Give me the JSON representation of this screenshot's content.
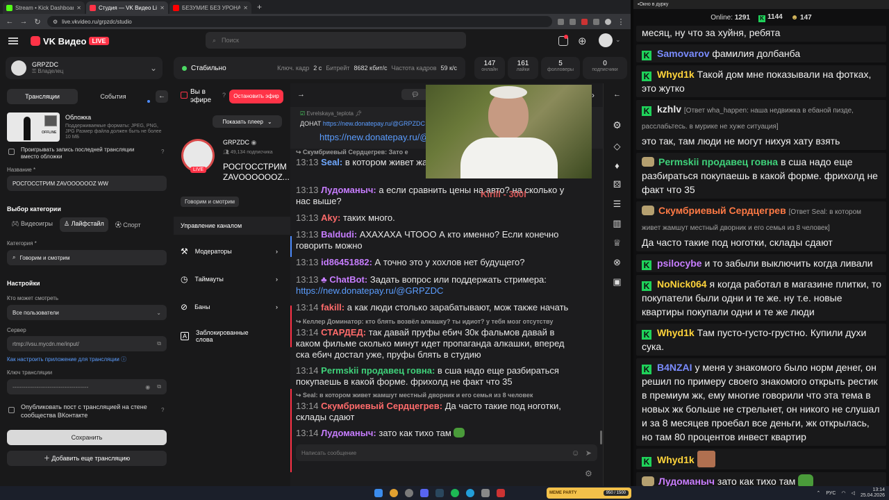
{
  "browser": {
    "tabs": [
      {
        "label": "Stream • Kick Dashboard",
        "icon_color": "#53fc18"
      },
      {
        "label": "Студия — VK Видео Live",
        "icon_color": "#ff3347"
      },
      {
        "label": "БЕЗУМИЕ БЕЗ УРОНА ЗА 4 ЧАСА",
        "icon_color": "#ff0000"
      }
    ],
    "url": "live.vkvideo.ru/grpzdc/studio"
  },
  "vk": {
    "logo_text": "VK Видео",
    "live_badge": "LIVE",
    "search_placeholder": "Поиск",
    "channel_name": "GRPZDC",
    "channel_role": "Владелец",
    "status": "Стабильно",
    "keyframe_label": "Ключ. кадр",
    "keyframe_value": "2 с",
    "bitrate_label": "Битрейт",
    "bitrate_value": "8682 кбит/с",
    "fps_label": "Частота кадров",
    "fps_value": "59 к/с",
    "stats": [
      {
        "value": "147",
        "label": "онлайн"
      },
      {
        "value": "161",
        "label": "лайки"
      },
      {
        "value": "5",
        "label": "фолловеры"
      },
      {
        "value": "0",
        "label": "подписчики"
      }
    ]
  },
  "left": {
    "tab_broadcasts": "Трансляции",
    "tab_events": "События",
    "cover_title": "Обложка",
    "cover_desc": "Поддерживаемые форматы: JPEG, PNG, JPG Размер файла должен быть не более 10 МБ",
    "cover_offline": "OFFLINE",
    "replay_label": "Проигрывать запись последней трансляции вместо обложки",
    "name_label": "Название *",
    "name_value": "РОСГОССТРИМ ZAVOOOOOOZ WW",
    "category_section": "Выбор категории",
    "cat_games": "Видеоигры",
    "cat_lifestyle": "Лайфстайл",
    "cat_sport": "Спорт",
    "category_label": "Категория *",
    "category_value": "Говорим и смотрим",
    "settings": "Настройки",
    "who_label": "Кто может смотреть",
    "who_value": "Все пользователи",
    "server_label": "Сервер",
    "server_value": "rtmp://vsu.mycdn.me/input/",
    "howto_link": "Как настроить приложение для трансляции",
    "key_label": "Ключ трансляции",
    "key_value": "-----------------------------------------",
    "publish_label": "Опубликовать пост с трансляцией на стене сообщества ВКонтакте",
    "save": "Сохранить",
    "add_more": "Добавить еще трансляцию"
  },
  "mid": {
    "on_air": "Вы в эфире",
    "stop": "Остановить эфир",
    "show_player": "Показать плеер",
    "channel_name": "GRPZDC",
    "subscribers": "49,134 подписчика",
    "stream_title": "РОСГОССТРИМ ZAVOOOOOOZ...",
    "live": "LIVE",
    "category_tag": "Говорим и смотрим",
    "manage": "Управление каналом",
    "menu": [
      "Модераторы",
      "Таймауты",
      "Баны",
      "Заблокированные слова"
    ]
  },
  "chat": {
    "input_placeholder": "Написать сообщение",
    "top_user": "Evrelskaya_teplota",
    "top_donate": "ДОНАТ",
    "top_donate_link": "https://new.donatepay.ru/@GRPZDC",
    "top_link2": "https://new.donatepay.ru/@",
    "overlay_caption": "Kirill - 300I",
    "reply1": "Скумбриевый Сердцегрев: Зато е",
    "reply2": "Келлер Доминатор: кто блять возвёл алкашку? ты идиот? у тебя мозг отсутству",
    "reply3": "Seal: в котором живет жамшут местный дворник и его семья из 8 человек",
    "messages": [
      {
        "time": "13:13",
        "user": "Seal:",
        "color": "#6fa8ff",
        "text": "в котором живет жа... 8 человек"
      },
      {
        "time": "13:13",
        "user": "Лудоманыч:",
        "color": "#c77dff",
        "text": "а если сравнить цены на авто? на сколько у нас выше?"
      },
      {
        "time": "13:13",
        "user": "Aky:",
        "color": "#ff6b6b",
        "text": "таких много."
      },
      {
        "time": "13:13",
        "user": "Baldudi:",
        "color": "#c77dff",
        "text": "АХАХАХА ЧТОOO А кто именно? Если конечно говорить можно"
      },
      {
        "time": "13:13",
        "user": "id86451882:",
        "color": "#c77dff",
        "text": "А точно это у хохлов нет будущего?"
      },
      {
        "time": "13:13",
        "user": "ChatBot:",
        "color": "#c77dff",
        "text": "Задать вопрос или поддержать стримера:",
        "link": "https://new.donatepay.ru/@GRPZDC"
      },
      {
        "time": "13:14",
        "user": "fakill:",
        "color": "#ff6b6b",
        "text": "а как люди столько зарабатывают, мож также начать"
      },
      {
        "time": "13:14",
        "user": "СТАРДЕД:",
        "color": "#ff6b6b",
        "text": "так давай пруфы ебич 30к фальмов давай в каком фильме сколько минут идет пропаганда алкашки, вперед ска ебич достал уже, пруфы блять в студию"
      },
      {
        "time": "13:14",
        "user": "Permskii продавец говна:",
        "color": "#3fd17a",
        "text": "в сша надо еще разбираться покупаешь в какой форме. фрихолд не факт что 35"
      },
      {
        "time": "13:14",
        "user": "Скумбриевый Сердцегрев:",
        "color": "#ff6b6b",
        "text": "Да часто такие под ноготки, склады сдают"
      },
      {
        "time": "13:14",
        "user": "Лудоманыч:",
        "color": "#c77dff",
        "text": "зато как тихо там"
      }
    ]
  },
  "kick": {
    "window_title": "Окно в дурку",
    "online_label": "Online:",
    "online_value": "1291",
    "followers": "1144",
    "viewers": "147",
    "messages": [
      {
        "user": "",
        "color": "#fff",
        "text": "месяц, ну что за хуйня, ребята",
        "badge": false
      },
      {
        "user": "Samovarov",
        "color": "#7a8cff",
        "text": "фамилия долбанба",
        "badge": true
      },
      {
        "user": "Whyd1k",
        "color": "#ffd43b",
        "text": "Такой дом мне показывали на фотках, это жутко",
        "badge": true
      },
      {
        "user": "kzhlv",
        "color": "#e6e6e6",
        "reply": "[Ответ wha_happen: наша недвижка в ебаной пизде, расслабьтесь. в мурике не хуже ситуация]",
        "text": "это так, там люди не могут нихуя хату взять",
        "badge": true
      },
      {
        "user": "Permskii продавец говна",
        "color": "#3fd17a",
        "text": "в сша надо еще разбираться покупаешь в какой форме. фрихолд не факт что 35",
        "badge": false
      },
      {
        "user": "Скумбриевый Сердцегрев",
        "color": "#ff7a45",
        "reply": "[Ответ Seal: в котором живет жамшут местный дворник и его семья из 8 человек]",
        "text": "Да часто такие под ноготки, склады сдают",
        "badge": false
      },
      {
        "user": "psilocybe",
        "color": "#c77dff",
        "text": "и то забыли выключить когда ливали",
        "badge": true
      },
      {
        "user": "NoNick064",
        "color": "#ffd43b",
        "text": "я когда работал в магазине плитки, то покупатели были одни и те же. ну т.е. новые квартиры покупали одни и те же люди",
        "badge": true
      },
      {
        "user": "Whyd1k",
        "color": "#ffd43b",
        "text": "Там пусто-густо-грустно. Купили духи сука.",
        "badge": true
      },
      {
        "user": "B4NZAI",
        "color": "#7a8cff",
        "text": "у меня у знакомого было норм денег, он решил по примеру своего знакомого открыть рестик в премиум жк, ему многие говорили что эта тема в новых жк больше не стрельнет, он никого не слушал и за 8 месяцев проебал все деньги, жк открылась, но там 80 процентов инвест квартир",
        "badge": true
      },
      {
        "user": "Whyd1k",
        "color": "#ffd43b",
        "text": "",
        "badge": true
      },
      {
        "user": "Лудоманыч",
        "color": "#c77dff",
        "text": "зато как тихо там",
        "badge": false
      }
    ]
  },
  "taskbar": {
    "time": "13:14",
    "date": "25.04.2026",
    "lang": "РУС",
    "meme_title": "MEME PARTY",
    "meme_progress": "950 / 1500"
  }
}
